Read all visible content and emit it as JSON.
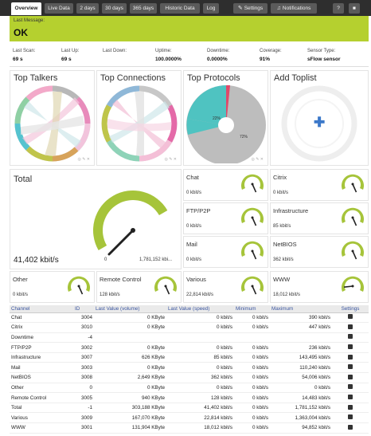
{
  "tabs": [
    {
      "label": "Overview",
      "active": true
    },
    {
      "label": "Live Data"
    },
    {
      "label": "2 days"
    },
    {
      "label": "30 days"
    },
    {
      "label": "365 days"
    },
    {
      "label": "Historic Data"
    },
    {
      "label": "Log"
    }
  ],
  "tab_buttons": {
    "settings": "Settings",
    "notifications": "Notifications"
  },
  "status": {
    "label": "Last Message:",
    "value": "OK",
    "color": "#b5d02f"
  },
  "stats": [
    {
      "key": "Last Scan:",
      "value": "69 s"
    },
    {
      "key": "Last Up:",
      "value": "69 s"
    },
    {
      "key": "Last Down:",
      "value": ""
    },
    {
      "key": "Uptime:",
      "value": "100.0000%"
    },
    {
      "key": "Downtime:",
      "value": "0.0000%"
    },
    {
      "key": "Coverage:",
      "value": "91%"
    },
    {
      "key": "Sensor Type:",
      "value": "sFlow sensor"
    }
  ],
  "toplists": {
    "talkers": "Top Talkers",
    "connections": "Top Connections",
    "protocols": "Top Protocols",
    "add": "Add Toplist",
    "pie_labels": {
      "a": "22%",
      "b": "72%"
    }
  },
  "total": {
    "title": "Total",
    "value": "41,402 kbit/s",
    "min": "0",
    "max": "1,781,152 kbi...",
    "level": 0.3
  },
  "gauges": [
    {
      "name": "Chat",
      "value": "0 kbit/s",
      "level": 0.6
    },
    {
      "name": "Citrix",
      "value": "0 kbit/s",
      "level": 0.6
    },
    {
      "name": "FTP/P2P",
      "value": "0 kbit/s",
      "level": 0.6
    },
    {
      "name": "Infrastructure",
      "value": "85 kbit/s",
      "level": 0.6
    },
    {
      "name": "Mail",
      "value": "0 kbit/s",
      "level": 0.6
    },
    {
      "name": "NetBIOS",
      "value": "362 kbit/s",
      "level": 0.6
    },
    {
      "name": "Other",
      "value": "0 kbit/s",
      "level": 0.6
    },
    {
      "name": "Remote Control",
      "value": "128 kbit/s",
      "level": 0.6
    },
    {
      "name": "Various",
      "value": "22,814 kbit/s",
      "level": 0.6
    },
    {
      "name": "WWW",
      "value": "18,012 kbit/s",
      "level": 0.15
    }
  ],
  "table": {
    "headers": [
      "Channel",
      "ID",
      "Last Value (volume)",
      "Last Value (speed)",
      "Minimum",
      "Maximum",
      "Settings"
    ],
    "rows": [
      [
        "Chat",
        "3004",
        "0 KByte",
        "0 kbit/s",
        "0 kbit/s",
        "390 kbit/s"
      ],
      [
        "Citrix",
        "3010",
        "0 KByte",
        "0 kbit/s",
        "0 kbit/s",
        "447 kbit/s"
      ],
      [
        "Downtime",
        "-4",
        "",
        "",
        "",
        ""
      ],
      [
        "FTP/P2P",
        "3002",
        "0 KByte",
        "0 kbit/s",
        "0 kbit/s",
        "236 kbit/s"
      ],
      [
        "Infrastructure",
        "3007",
        "626 KByte",
        "85 kbit/s",
        "0 kbit/s",
        "143,495 kbit/s"
      ],
      [
        "Mail",
        "3003",
        "0 KByte",
        "0 kbit/s",
        "0 kbit/s",
        "110,240 kbit/s"
      ],
      [
        "NetBIOS",
        "3008",
        "2,649 KByte",
        "362 kbit/s",
        "0 kbit/s",
        "54,006 kbit/s"
      ],
      [
        "Other",
        "0",
        "0 KByte",
        "0 kbit/s",
        "0 kbit/s",
        "0 kbit/s"
      ],
      [
        "Remote Control",
        "3005",
        "940 KByte",
        "128 kbit/s",
        "0 kbit/s",
        "14,483 kbit/s"
      ],
      [
        "Total",
        "-1",
        "303,188 KByte",
        "41,402 kbit/s",
        "0 kbit/s",
        "1,781,152 kbit/s"
      ],
      [
        "Various",
        "3009",
        "167,070 KByte",
        "22,814 kbit/s",
        "0 kbit/s",
        "1,363,004 kbit/s"
      ],
      [
        "WWW",
        "3001",
        "131,904 KByte",
        "18,012 kbit/s",
        "0 kbit/s",
        "94,852 kbit/s"
      ]
    ]
  }
}
